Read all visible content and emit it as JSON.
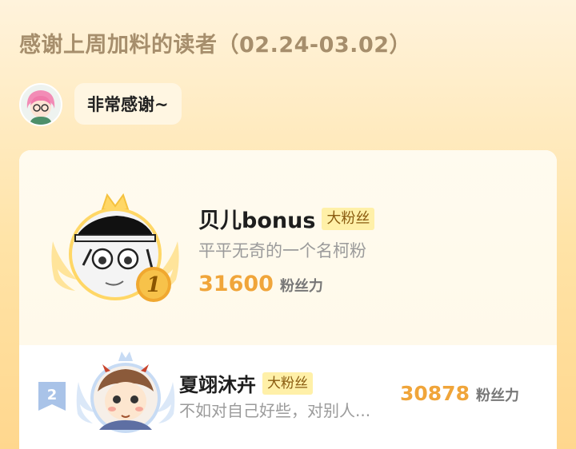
{
  "header": {
    "title": "感谢上周加料的读者（02.24-03.02）"
  },
  "host": {
    "avatar_icon": "anime-girl-avatar-icon",
    "message": "非常感谢~"
  },
  "ranking": [
    {
      "rank": "1",
      "name": "贝儿bonus",
      "badge": "大粉丝",
      "description": "平平无奇的一个名柯粉",
      "score": "31600",
      "unit": "粉丝力",
      "avatar_icon": "anime-detective-avatar-icon",
      "medal_icon": "gold-medal-icon"
    },
    {
      "rank": "2",
      "name": "夏翊沐卉",
      "badge": "大粉丝",
      "description": "不如对自己好些，对别人...",
      "score": "30878",
      "unit": "粉丝力",
      "avatar_icon": "anime-character-avatar-icon",
      "medal_icon": "silver-rank-badge-icon"
    }
  ],
  "colors": {
    "accent": "#f0a53a",
    "gold": "#f2c14e",
    "silver": "#a9c3e8",
    "badge_bg": "#fff0a8"
  }
}
